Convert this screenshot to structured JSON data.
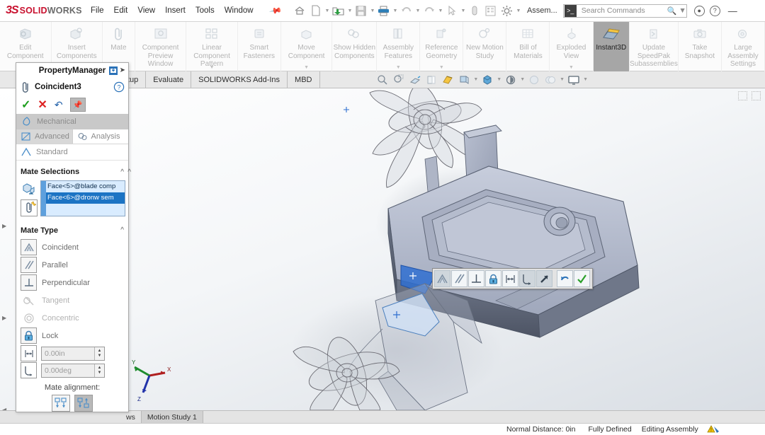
{
  "app": {
    "brand_3d": "3S",
    "brand_solid": "SOLID",
    "brand_works": "WORKS",
    "document_label": "Assem...",
    "accent_red": "#c8102e",
    "accent_blue": "#1c74c4",
    "active_tile_bg": "#a6a6a6"
  },
  "menubar": {
    "items": [
      "File",
      "Edit",
      "View",
      "Insert",
      "Tools",
      "Window"
    ],
    "pin_icon": "pushpin-icon"
  },
  "quick_access": {
    "icons": [
      "home-icon",
      "new-document-icon",
      "open-folder-icon",
      "save-icon",
      "print-icon",
      "undo-icon",
      "redo-icon",
      "select-cursor-icon",
      "link-icon",
      "options-grid-icon",
      "gear-icon"
    ]
  },
  "search": {
    "placeholder": "Search Commands",
    "icon": "command-prompt-icon",
    "magnifier": "search-icon"
  },
  "window_controls": {
    "account_icon": "user-account-icon",
    "help_icon": "help-question-icon",
    "minimize_label": "—"
  },
  "ribbon": {
    "commands": [
      {
        "label": "Edit Component",
        "icon": "edit-component-icon",
        "active": false,
        "caret": false
      },
      {
        "label": "Insert Components",
        "icon": "insert-components-icon",
        "active": false,
        "caret": true
      },
      {
        "label": "Mate",
        "icon": "mate-paperclip-icon",
        "active": false,
        "caret": false
      },
      {
        "label": "Component Preview Window",
        "icon": "component-preview-icon",
        "active": false,
        "caret": false
      },
      {
        "label": "Linear Component Pattern",
        "icon": "linear-pattern-icon",
        "active": false,
        "caret": true
      },
      {
        "label": "Smart Fasteners",
        "icon": "smart-fasteners-icon",
        "active": false,
        "caret": false
      },
      {
        "label": "Move Component",
        "icon": "move-component-icon",
        "active": false,
        "caret": true
      },
      {
        "label": "Show Hidden Components",
        "icon": "show-hidden-components-icon",
        "active": false,
        "caret": false
      },
      {
        "label": "Assembly Features",
        "icon": "assembly-features-icon",
        "active": false,
        "caret": true
      },
      {
        "label": "Reference Geometry",
        "icon": "reference-geometry-icon",
        "active": false,
        "caret": true
      },
      {
        "label": "New Motion Study",
        "icon": "new-motion-study-icon",
        "active": false,
        "caret": false
      },
      {
        "label": "Bill of Materials",
        "icon": "bill-of-materials-icon",
        "active": false,
        "caret": false
      },
      {
        "label": "Exploded View",
        "icon": "exploded-view-icon",
        "active": false,
        "caret": true
      },
      {
        "label": "Instant3D",
        "icon": "instant3d-icon",
        "active": true,
        "caret": false
      },
      {
        "label": "Update SpeedPak Subassemblies",
        "icon": "update-speedpak-icon",
        "active": false,
        "caret": false
      },
      {
        "label": "Take Snapshot",
        "icon": "take-snapshot-camera-icon",
        "active": false,
        "caret": false
      },
      {
        "label": "Large Assembly Settings",
        "icon": "large-assembly-settings-icon",
        "active": false,
        "caret": false
      }
    ]
  },
  "tabs": {
    "items": [
      "tup",
      "Evaluate",
      "SOLIDWORKS Add-Ins",
      "MBD"
    ],
    "viewport_tools": [
      "zoom-to-fit-icon",
      "zoom-to-area-icon",
      "rotate-view-icon",
      "section-view-icon",
      "view-orientation-icon",
      "display-style-icon",
      "hide-show-icon",
      "edit-appearance-icon",
      "apply-scene-icon",
      "view-settings-icon"
    ]
  },
  "property_manager": {
    "panel_title": "PropertyManager",
    "feature_name": "Coincident3",
    "feature_icon": "mate-paperclip-icon",
    "help_icon": "help-question-icon",
    "pin_icons": [
      "keep-visible-icon",
      "pushpin-icon"
    ],
    "actions": {
      "ok": "✓",
      "cancel": "✕",
      "undo": "↶",
      "pin": "pushpin-icon"
    },
    "mate_tabs": {
      "mechanical": "Mechanical",
      "advanced": "Advanced",
      "analysis": "Analysis",
      "standard": "Standard"
    },
    "mate_selections": {
      "header": "Mate Selections",
      "entries": [
        {
          "text": "Face<5>@blade comp",
          "highlighted": false
        },
        {
          "text": "Face<6>@dronw sem",
          "highlighted": true
        }
      ],
      "icons": [
        "entities-to-mate-icon",
        "multiple-mate-mode-icon"
      ]
    },
    "mate_type": {
      "header": "Mate Type",
      "options": [
        {
          "label": "Coincident",
          "icon": "coincident-icon",
          "enabled": true
        },
        {
          "label": "Parallel",
          "icon": "parallel-icon",
          "enabled": true
        },
        {
          "label": "Perpendicular",
          "icon": "perpendicular-icon",
          "enabled": true
        },
        {
          "label": "Tangent",
          "icon": "tangent-icon",
          "enabled": false
        },
        {
          "label": "Concentric",
          "icon": "concentric-icon",
          "enabled": false
        },
        {
          "label": "Lock",
          "icon": "lock-icon",
          "enabled": true
        }
      ],
      "distance": {
        "value": "0.00in",
        "icon": "distance-icon"
      },
      "angle": {
        "value": "0.00deg",
        "icon": "angle-icon"
      }
    },
    "mate_alignment": {
      "label": "Mate alignment:",
      "buttons": [
        {
          "icon": "aligned-icon",
          "selected": false
        },
        {
          "icon": "anti-aligned-icon",
          "selected": true
        }
      ]
    }
  },
  "viewport": {
    "model_description": "drone arm assembly with propeller",
    "triad": {
      "x_label": "X",
      "y_label": "Y",
      "z_label": "Z",
      "x_color": "#b02020",
      "y_color": "#1e8c2e",
      "z_color": "#2233aa"
    },
    "mate_popup_toolbar": {
      "items": [
        {
          "icon": "coincident-icon",
          "selected": true
        },
        {
          "icon": "parallel-icon",
          "selected": false
        },
        {
          "icon": "perpendicular-icon",
          "selected": false
        },
        {
          "icon": "lock-icon",
          "selected": false
        },
        {
          "icon": "distance-icon",
          "selected": false
        },
        {
          "icon": "angle-icon",
          "selected": true
        },
        {
          "icon": "arrow-flip-icon",
          "selected": true
        },
        {
          "icon": "undo-icon",
          "selected": false
        },
        {
          "icon": "confirm-check-icon",
          "selected": false
        }
      ]
    }
  },
  "bottom_tabs": {
    "items": [
      "ws",
      "Motion Study 1"
    ]
  },
  "status_bar": {
    "normal_distance": "Normal Distance: 0in",
    "definition_state": "Fully Defined",
    "edit_mode": "Editing Assembly",
    "warning_icon": "rebuild-warning-icon"
  }
}
